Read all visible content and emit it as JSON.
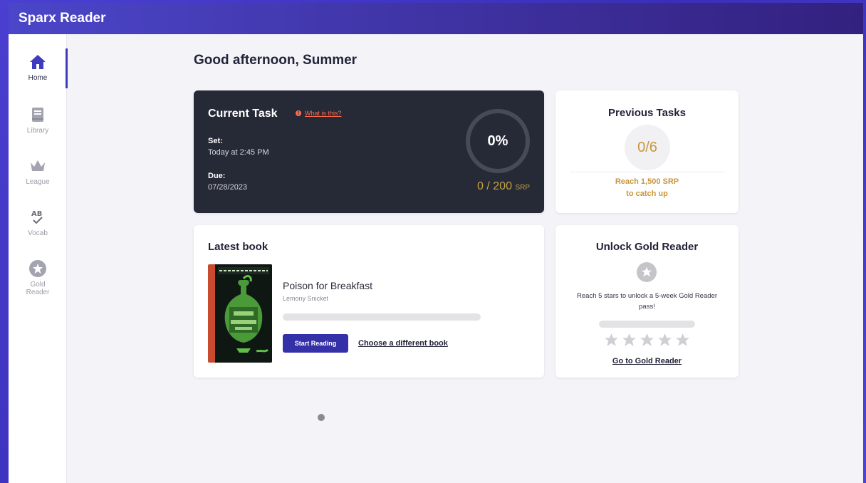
{
  "app": {
    "title": "Sparx Reader"
  },
  "nav": {
    "items": [
      {
        "label": "Home",
        "icon": "home-icon",
        "active": true
      },
      {
        "label": "Library",
        "icon": "book-icon",
        "active": false
      },
      {
        "label": "League",
        "icon": "crown-icon",
        "active": false
      },
      {
        "label": "Vocab",
        "icon": "ab-check-icon",
        "active": false
      },
      {
        "label": "Gold Reader",
        "icon": "star-circle-icon",
        "active": false
      }
    ]
  },
  "greeting": "Good afternoon, Summer",
  "current_task": {
    "title": "Current Task",
    "what_is_this": "What is this?",
    "set_label": "Set:",
    "set_value": "Today at 2:45 PM",
    "due_label": "Due:",
    "due_value": "07/28/2023",
    "percent": "0%",
    "srp_value": "0 / 200",
    "srp_unit": "SRP"
  },
  "previous_tasks": {
    "title": "Previous Tasks",
    "count": "0/6",
    "note_line1": "Reach 1,500 SRP",
    "note_line2": "to catch up"
  },
  "latest_book": {
    "title": "Latest book",
    "book_title": "Poison for Breakfast",
    "author": "Lemony Snicket",
    "progress": 0,
    "start_label": "Start Reading",
    "choose_label": "Choose a different book"
  },
  "gold_reader": {
    "title": "Unlock Gold Reader",
    "description": "Reach 5 stars to unlock a 5-week Gold Reader pass!",
    "progress": 0,
    "stars_earned": 0,
    "stars_total": 5,
    "link_label": "Go to Gold Reader"
  },
  "colors": {
    "accent": "#3f3bbf",
    "gold": "#c8963e",
    "task_card": "#262a36",
    "alert": "#ff6a4d"
  }
}
